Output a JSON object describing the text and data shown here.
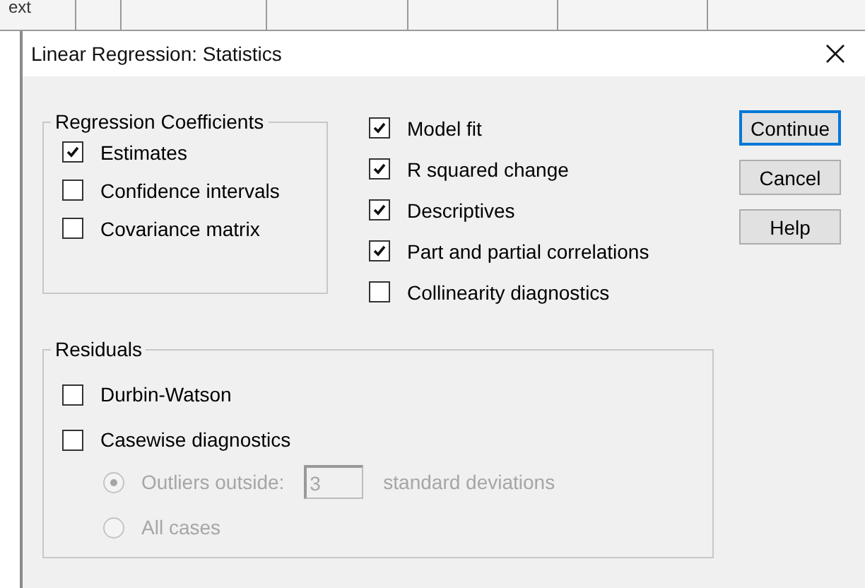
{
  "background": {
    "column_header_text": "ext"
  },
  "dialog": {
    "title": "Linear Regression: Statistics"
  },
  "regression_coefficients": {
    "title": "Regression Coefficients",
    "options": [
      {
        "label": "Estimates",
        "checked": true
      },
      {
        "label": "Confidence intervals",
        "checked": false
      },
      {
        "label": "Covariance matrix",
        "checked": false
      }
    ]
  },
  "other_options": [
    {
      "label": "Model fit",
      "checked": true
    },
    {
      "label": "R squared change",
      "checked": true
    },
    {
      "label": "Descriptives",
      "checked": true
    },
    {
      "label": "Part and partial correlations",
      "checked": true
    },
    {
      "label": "Collinearity diagnostics",
      "checked": false
    }
  ],
  "buttons": [
    {
      "label": "Continue",
      "default": true
    },
    {
      "label": "Cancel",
      "default": false
    },
    {
      "label": "Help",
      "default": false
    }
  ],
  "residuals": {
    "title": "Residuals",
    "options": [
      {
        "label": "Durbin-Watson",
        "checked": false
      },
      {
        "label": "Casewise diagnostics",
        "checked": false
      }
    ],
    "casewise": {
      "disabled": true,
      "choices": [
        {
          "kind": "threshold",
          "label": "Outliers outside:",
          "selected": true,
          "value": "3",
          "unit": "standard deviations"
        },
        {
          "kind": "plain",
          "label": "All cases",
          "selected": false
        }
      ]
    }
  }
}
